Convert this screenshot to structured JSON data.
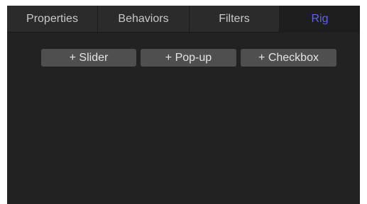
{
  "tabs": [
    {
      "label": "Properties",
      "active": false
    },
    {
      "label": "Behaviors",
      "active": false
    },
    {
      "label": "Filters",
      "active": false
    },
    {
      "label": "Rig",
      "active": true
    }
  ],
  "buttons": {
    "slider": "+ Slider",
    "popup": "+ Pop-up",
    "checkbox": "+ Checkbox"
  },
  "colors": {
    "panel_background": "#222222",
    "tab_background": "#2b2b2b",
    "active_tab_text": "#5f63e8",
    "button_background": "#4f4f4f"
  }
}
